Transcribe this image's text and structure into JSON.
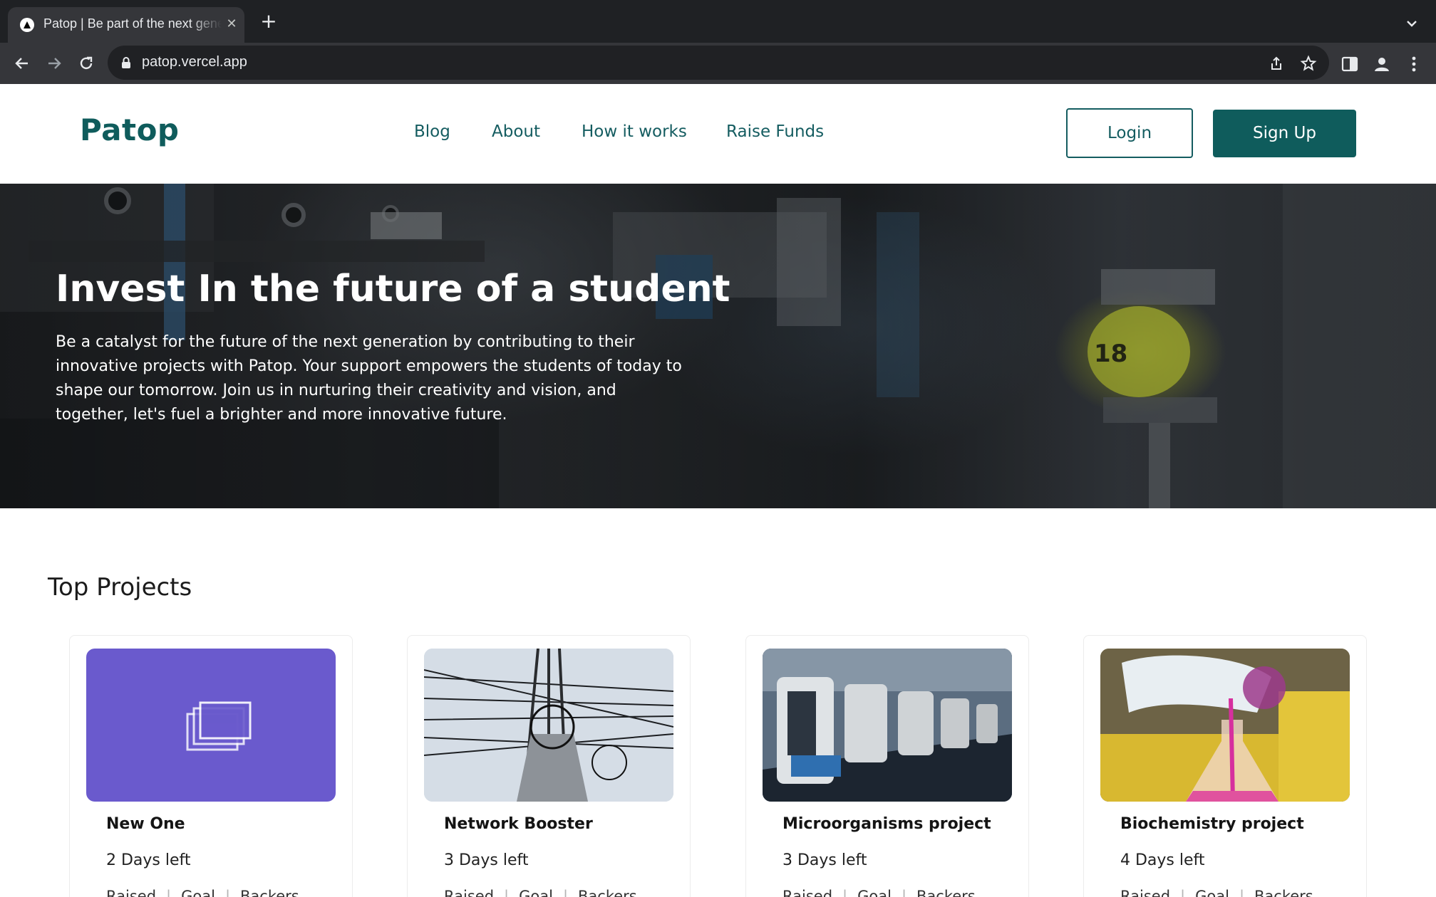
{
  "browser": {
    "tab_title": "Patop | Be part of the next generation",
    "url": "patop.vercel.app",
    "icons": [
      "app-favicon",
      "close-icon",
      "plus-icon",
      "chevron-down-icon",
      "back-arrow-icon",
      "forward-arrow-icon",
      "reload-icon",
      "lock-icon",
      "share-icon",
      "star-icon",
      "side-panel-icon",
      "profile-icon",
      "kebab-menu-icon"
    ]
  },
  "site": {
    "logo": "Patop",
    "nav": [
      "Blog",
      "About",
      "How it works",
      "Raise Funds"
    ],
    "login_label": "Login",
    "signup_label": "Sign Up",
    "colors": {
      "brand": "#0f5c5c",
      "card_placeholder": "#6a5acd"
    }
  },
  "hero": {
    "title": "Invest In the future of a student",
    "text": "Be a catalyst for the future of the next generation by contributing to their innovative projects with Patop. Your support empowers the students of today to shape our tomorrow. Join us in nurturing their creativity and vision, and together, let's fuel a brighter and more innovative future.",
    "image_label": "18"
  },
  "projects": {
    "title": "Top Projects",
    "stat_labels": [
      "Raised",
      "Goal",
      "Backers"
    ],
    "items": [
      {
        "title": "New One",
        "days_left": "2 Days left",
        "image": "placeholder-gallery-icon"
      },
      {
        "title": "Network Booster",
        "days_left": "3 Days left",
        "image": "power-lines-photo"
      },
      {
        "title": "Microorganisms project",
        "days_left": "3 Days left",
        "image": "microscopes-photo"
      },
      {
        "title": "Biochemistry project",
        "days_left": "4 Days left",
        "image": "lab-flask-photo"
      }
    ]
  }
}
